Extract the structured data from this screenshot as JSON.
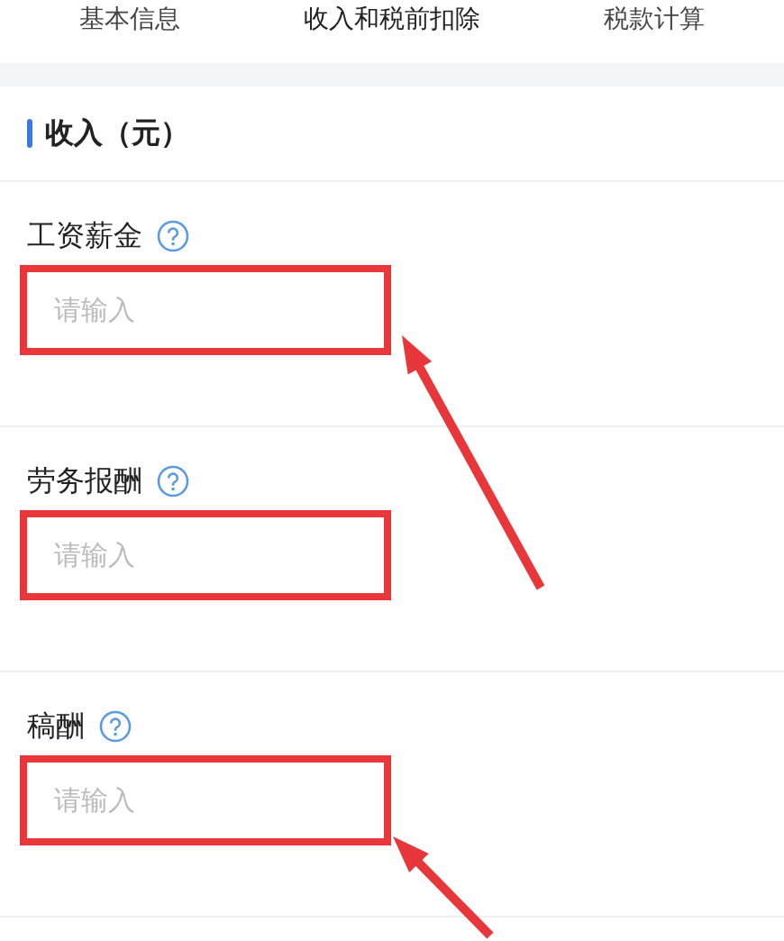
{
  "tabs": [
    {
      "label": "基本信息",
      "selected": false
    },
    {
      "label": "收入和税前扣除",
      "selected": true
    },
    {
      "label": "税款计算",
      "selected": false
    }
  ],
  "section": {
    "title": "收入（元）"
  },
  "fields": [
    {
      "label": "工资薪金",
      "placeholder": "请输入",
      "highlighted": true
    },
    {
      "label": "劳务报酬",
      "placeholder": "请输入",
      "highlighted": true
    },
    {
      "label": "稿酬",
      "placeholder": "请输入",
      "highlighted": true
    }
  ]
}
